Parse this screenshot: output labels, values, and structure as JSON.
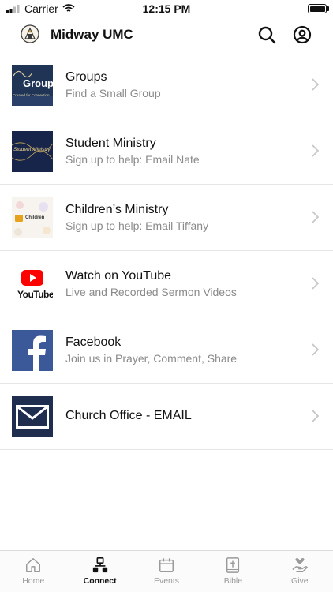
{
  "status_bar": {
    "carrier": "Carrier",
    "time": "12:15 PM",
    "battery_level": 1.0
  },
  "header": {
    "title": "Midway UMC"
  },
  "list": [
    {
      "title": "Groups",
      "subtitle": "Find a Small Group",
      "thumb_text": "Group",
      "thumb_caption": "Created for Connection"
    },
    {
      "title": "Student Ministry",
      "subtitle": "Sign up to help: Email Nate",
      "thumb_text": "Student Ministry"
    },
    {
      "title": "Children’s Ministry",
      "subtitle": "Sign up to help: Email Tiffany",
      "thumb_text": "Children"
    },
    {
      "title": "Watch on YouTube",
      "subtitle": "Live and Recorded Sermon Videos",
      "thumb_text": "YouTube"
    },
    {
      "title": "Facebook",
      "subtitle": "Join us in Prayer, Comment, Share"
    },
    {
      "title": "Church Office - EMAIL"
    }
  ],
  "tabs": [
    {
      "label": "Home",
      "icon": "home-icon",
      "active": false
    },
    {
      "label": "Connect",
      "icon": "connect-icon",
      "active": true
    },
    {
      "label": "Events",
      "icon": "calendar-icon",
      "active": false
    },
    {
      "label": "Bible",
      "icon": "bible-icon",
      "active": false
    },
    {
      "label": "Give",
      "icon": "give-icon",
      "active": false
    }
  ],
  "colors": {
    "accent": "#111111",
    "inactive": "#9a9a9a",
    "divider": "#e6e6e6",
    "youtube_red": "#ff0000",
    "facebook_blue": "#3b5998",
    "email_navy": "#1f2d4f"
  }
}
